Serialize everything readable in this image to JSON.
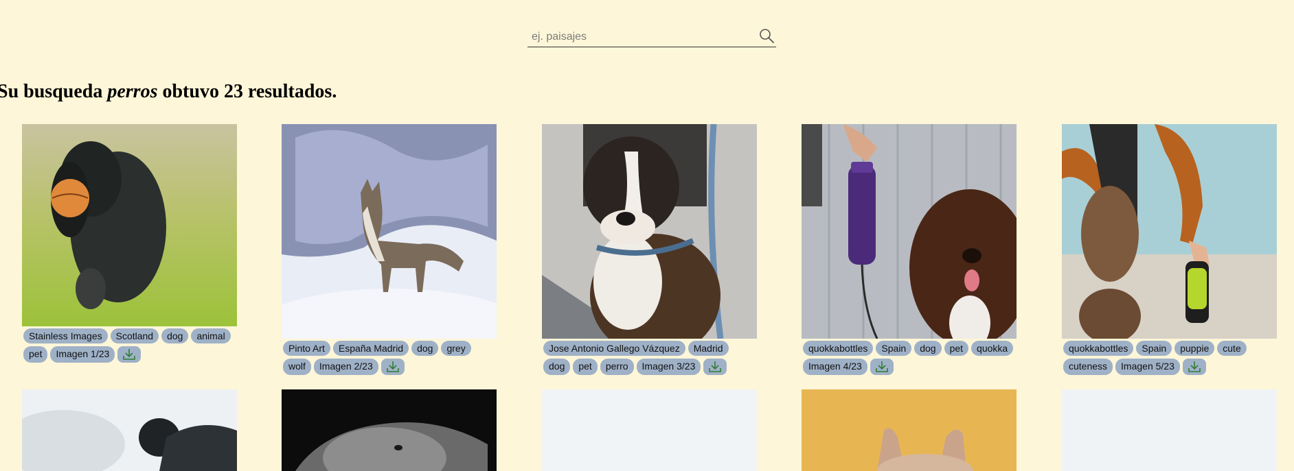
{
  "search": {
    "placeholder": "ej. paisajes"
  },
  "result": {
    "prefix": "Su busqueda",
    "query": "perros",
    "suffix": "obtuvo 23 resultados."
  },
  "cards": [
    {
      "tags": [
        "Stainless Images",
        "Scotland",
        "dog",
        "animal",
        "pet"
      ],
      "counter": "Imagen 1/23"
    },
    {
      "tags": [
        "Pinto Art",
        "España Madrid",
        "dog",
        "grey",
        "wolf"
      ],
      "counter": "Imagen 2/23"
    },
    {
      "tags": [
        "Jose Antonio Gallego Vázquez",
        "Madrid",
        "dog",
        "pet",
        "perro"
      ],
      "counter": "Imagen 3/23"
    },
    {
      "tags": [
        "quokkabottles",
        "Spain",
        "dog",
        "pet",
        "quokka"
      ],
      "counter": "Imagen 4/23"
    },
    {
      "tags": [
        "quokkabottles",
        "Spain",
        "puppie",
        "cute",
        "cuteness"
      ],
      "counter": "Imagen 5/23"
    }
  ],
  "icons": {
    "search": "search-icon",
    "download": "download-icon"
  },
  "colors": {
    "background": "#fdf6d8",
    "tag": "#9fb1c7",
    "download_arrow": "#2e7d32"
  }
}
